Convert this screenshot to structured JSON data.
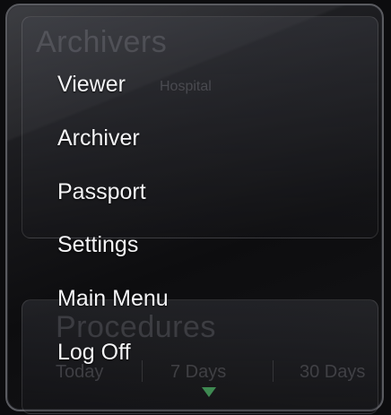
{
  "background": {
    "archivers": {
      "title": "Archivers",
      "subtitle": "Hospital"
    },
    "procedures": {
      "title": "Procedures",
      "tabs": [
        "Today",
        "7 Days",
        "30 Days"
      ]
    },
    "colors": {
      "indicator": "#3e8a52"
    }
  },
  "menu": {
    "items": [
      {
        "label": "Viewer"
      },
      {
        "label": "Archiver"
      },
      {
        "label": "Passport"
      },
      {
        "label": "Settings"
      },
      {
        "label": "Main Menu"
      },
      {
        "label": "Log Off"
      }
    ]
  }
}
